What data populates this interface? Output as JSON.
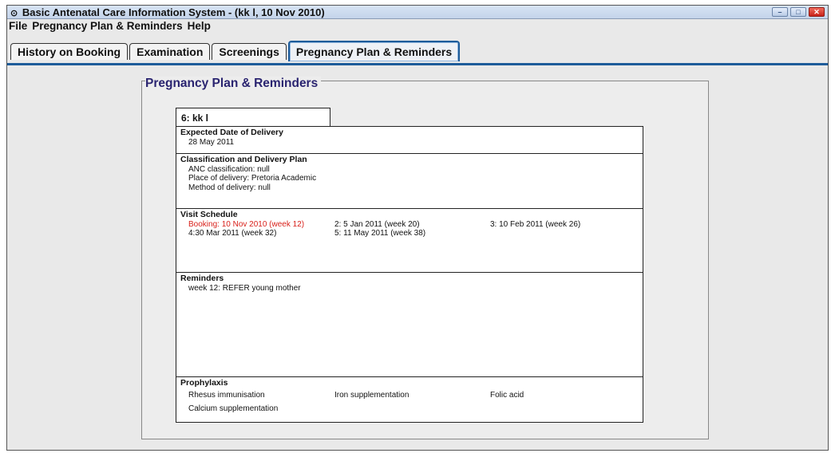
{
  "window": {
    "title": "Basic Antenatal Care Information System - (kk l, 10 Nov 2010)",
    "title_icon": "app-icon"
  },
  "menu": [
    "File",
    "Pregnancy Plan & Reminders",
    "Help"
  ],
  "tabs": [
    {
      "label": "History on Booking",
      "active": false
    },
    {
      "label": "Examination",
      "active": false
    },
    {
      "label": "Screenings",
      "active": false
    },
    {
      "label": "Pregnancy Plan & Reminders",
      "active": true
    }
  ],
  "panel": {
    "title": "Pregnancy Plan & Reminders",
    "patient": "6: kk l",
    "edd": {
      "title": "Expected Date of Delivery",
      "value": "28 May 2011"
    },
    "classification": {
      "title": "Classification and Delivery Plan",
      "lines": [
        "ANC classification: null",
        "Place of delivery: Pretoria Academic",
        "Method of delivery: null"
      ]
    },
    "visits": {
      "title": "Visit Schedule",
      "items": [
        "Booking: 10 Nov 2010 (week 12)",
        "2: 5 Jan 2011 (week 20)",
        "3: 10 Feb 2011 (week 26)",
        "4:30 Mar 2011 (week 32)",
        "5: 11 May 2011 (week 38)"
      ],
      "highlight_color": "#d8201a"
    },
    "reminders": {
      "title": "Reminders",
      "items": [
        "week 12: REFER young mother"
      ]
    },
    "prophylaxis": {
      "title": "Prophylaxis",
      "items": [
        "Rhesus immunisation",
        "Iron supplementation",
        "Folic acid",
        "Calcium supplementation"
      ]
    }
  },
  "colors": {
    "tab_accent": "#1e5c9a",
    "panel_title": "#2a2470"
  }
}
